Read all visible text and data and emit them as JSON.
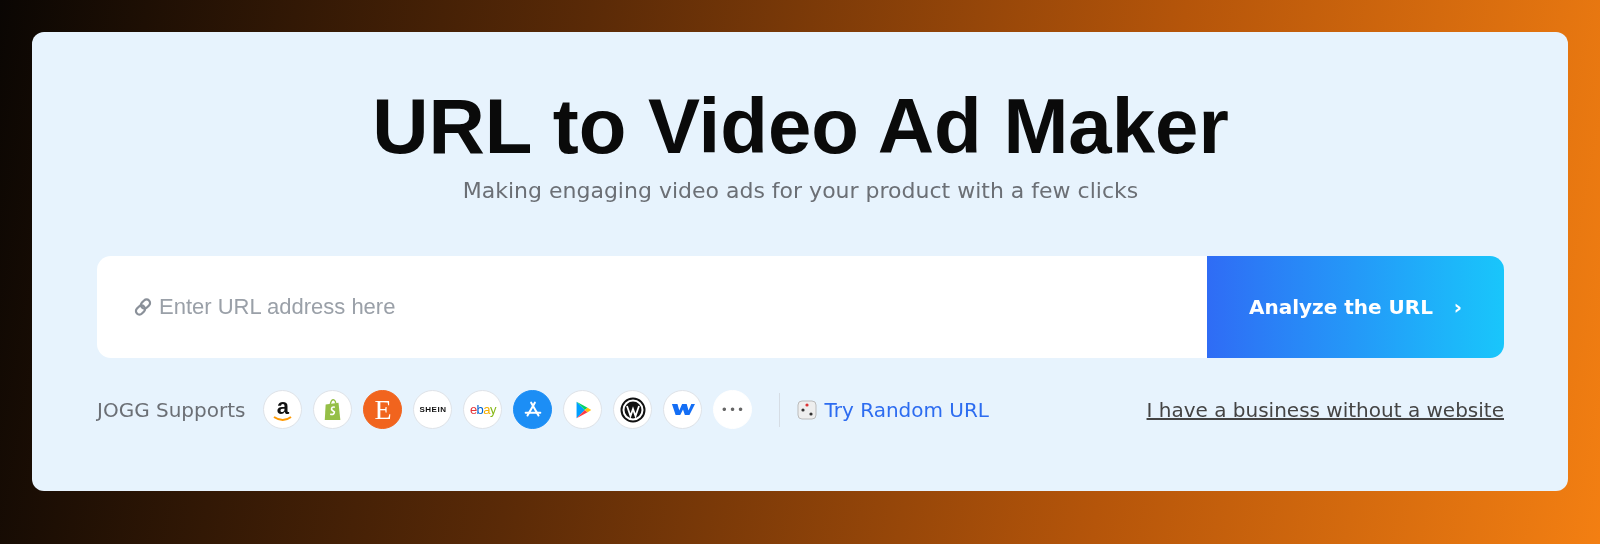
{
  "title": "URL to Video Ad Maker",
  "subtitle": "Making engaging video ads for your product with a few clicks",
  "url_field": {
    "placeholder": "Enter URL address here"
  },
  "analyze_button": {
    "label": "Analyze the URL",
    "chevron": "›"
  },
  "supports_label": "JOGG Supports",
  "platforms": [
    {
      "kind": "amazon",
      "text": "a"
    },
    {
      "kind": "shopify"
    },
    {
      "kind": "etsy",
      "text": "E"
    },
    {
      "kind": "shein",
      "text": "SHEIN"
    },
    {
      "kind": "ebay",
      "text": "ebay"
    },
    {
      "kind": "appstore"
    },
    {
      "kind": "googleplay"
    },
    {
      "kind": "wordpress"
    },
    {
      "kind": "webflow"
    },
    {
      "kind": "more",
      "text": "•••"
    }
  ],
  "random_link": "Try Random URL",
  "no_website_link": "I have a business without a website"
}
